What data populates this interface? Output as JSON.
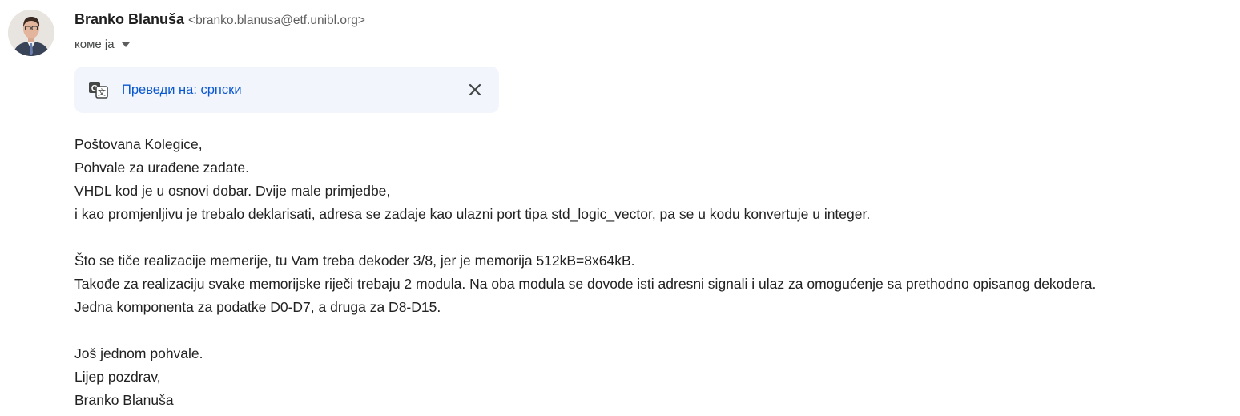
{
  "sender": {
    "name": "Branko Blanuša",
    "email": "<branko.blanusa@etf.unibl.org>"
  },
  "recipient": {
    "label": "коме ја"
  },
  "translate_bar": {
    "link_label": "Преведи на: српски",
    "icon": "translate-icon",
    "close_icon": "close-icon"
  },
  "message": {
    "lines": [
      "Poštovana Kolegice,",
      "Pohvale za urađene zadate.",
      "VHDL kod je u osnovi dobar. Dvije male primjedbe,",
      "i kao promjenljivu je trebalo deklarisati, adresa se zadaje kao ulazni port tipa std_logic_vector, pa se u kodu konvertuje u integer.",
      "",
      "Što se tiče realizacije memerije, tu Vam treba dekoder 3/8, jer je memorija 512kB=8x64kB.",
      "Takođe za realizaciju svake memorijske riječi trebaju 2 modula. Na oba modula se dovode isti adresni signali i ulaz za omogućenje sa prethodno opisanog dekodera.",
      "Jedna komponenta za podatke D0-D7, a druga za D8-D15.",
      "",
      "Još jednom pohvale.",
      "Lijep pozdrav,",
      "Branko Blanuša"
    ]
  },
  "colors": {
    "link": "#0b57d0",
    "translate_bg": "#f2f6fc",
    "muted": "#5e5e5e"
  }
}
